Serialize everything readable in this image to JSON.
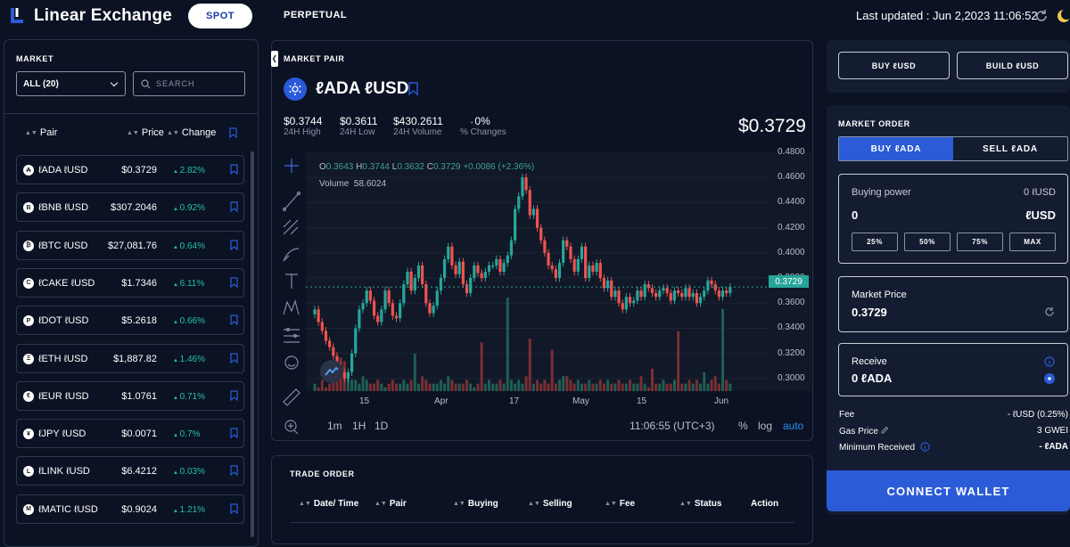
{
  "header": {
    "brand": "Linear Exchange",
    "tabs": [
      "SPOT",
      "PERPETUAL"
    ],
    "last_updated": "Last updated : Jun 2,2023 11:06:52"
  },
  "market": {
    "title": "MARKET",
    "filter": "ALL (20)",
    "search_placeholder": "SEARCH",
    "columns": [
      "Pair",
      "Price",
      "Change"
    ],
    "rows": [
      {
        "icon": "₳",
        "pair": "ℓADA ℓUSD",
        "price": "$0.3729",
        "change": "2.82%"
      },
      {
        "icon": "B",
        "pair": "ℓBNB ℓUSD",
        "price": "$307.2046",
        "change": "0.92%"
      },
      {
        "icon": "₿",
        "pair": "ℓBTC ℓUSD",
        "price": "$27,081.76",
        "change": "0.64%"
      },
      {
        "icon": "C",
        "pair": "ℓCAKE ℓUSD",
        "price": "$1.7346",
        "change": "6.11%"
      },
      {
        "icon": "P",
        "pair": "ℓDOT ℓUSD",
        "price": "$5.2618",
        "change": "0.66%"
      },
      {
        "icon": "Ξ",
        "pair": "ℓETH ℓUSD",
        "price": "$1,887.82",
        "change": "1.46%"
      },
      {
        "icon": "€",
        "pair": "ℓEUR ℓUSD",
        "price": "$1.0761",
        "change": "0.71%"
      },
      {
        "icon": "¥",
        "pair": "ℓJPY ℓUSD",
        "price": "$0.0071",
        "change": "0.7%"
      },
      {
        "icon": "L",
        "pair": "ℓLINK ℓUSD",
        "price": "$6.4212",
        "change": "0.03%"
      },
      {
        "icon": "M",
        "pair": "ℓMATIC ℓUSD",
        "price": "$0.9024",
        "change": "1.21%"
      }
    ]
  },
  "pair_panel": {
    "label": "MARKET PAIR",
    "pair": "ℓADA ℓUSD",
    "stats": [
      {
        "value": "$0.3744",
        "label": "24H High"
      },
      {
        "value": "$0.3611",
        "label": "24H Low"
      },
      {
        "value": "$430.2611",
        "label": "24H Volume"
      },
      {
        "value": "0%",
        "label": "% Changes"
      }
    ],
    "price": "$0.3729"
  },
  "chart": {
    "ohlc": {
      "o": "0.3643",
      "h": "0.3744",
      "l": "0.3632",
      "c": "0.3729",
      "chg": "+0.0086 (+2.36%)"
    },
    "volume": "58.6024",
    "last_price_tag": "0.3729",
    "x_ticks": [
      "15",
      "Apr",
      "17",
      "May",
      "15",
      "Jun"
    ],
    "intervals": [
      "1m",
      "1H",
      "1D"
    ],
    "clock": "11:06:55 (UTC+3)",
    "options": [
      "%",
      "log",
      "auto"
    ]
  },
  "chart_data": {
    "type": "candlestick",
    "y_ticks": [
      "0.4800",
      "0.4600",
      "0.4400",
      "0.4200",
      "0.4000",
      "0.3800",
      "0.3600",
      "0.3400",
      "0.3200",
      "0.3000"
    ],
    "ylim": [
      0.29,
      0.48
    ],
    "close": [
      0.355,
      0.345,
      0.338,
      0.33,
      0.325,
      0.318,
      0.31,
      0.305,
      0.3,
      0.305,
      0.32,
      0.34,
      0.355,
      0.36,
      0.37,
      0.362,
      0.35,
      0.345,
      0.355,
      0.37,
      0.36,
      0.35,
      0.348,
      0.36,
      0.375,
      0.385,
      0.37,
      0.38,
      0.39,
      0.375,
      0.36,
      0.352,
      0.358,
      0.37,
      0.38,
      0.395,
      0.405,
      0.39,
      0.383,
      0.393,
      0.375,
      0.368,
      0.38,
      0.39,
      0.384,
      0.38,
      0.385,
      0.39,
      0.39,
      0.395,
      0.385,
      0.392,
      0.398,
      0.41,
      0.435,
      0.445,
      0.46,
      0.45,
      0.43,
      0.435,
      0.42,
      0.41,
      0.4,
      0.39,
      0.387,
      0.38,
      0.392,
      0.41,
      0.405,
      0.395,
      0.385,
      0.395,
      0.405,
      0.38,
      0.39,
      0.385,
      0.392,
      0.38,
      0.372,
      0.378,
      0.365,
      0.37,
      0.36,
      0.355,
      0.365,
      0.36,
      0.362,
      0.37,
      0.365,
      0.375,
      0.372,
      0.368,
      0.365,
      0.37,
      0.372,
      0.368,
      0.362,
      0.37,
      0.368,
      0.365,
      0.372,
      0.365,
      0.368,
      0.36,
      0.365,
      0.37,
      0.378,
      0.375,
      0.37,
      0.365,
      0.37,
      0.368,
      0.3729
    ],
    "volume": [
      2,
      1,
      3,
      1,
      2,
      4,
      6,
      9,
      8,
      5,
      3,
      3,
      2,
      4,
      3,
      2,
      2,
      3,
      2,
      1,
      2,
      3,
      2,
      2,
      3,
      2,
      3,
      10,
      2,
      4,
      3,
      2,
      2,
      2,
      3,
      2,
      4,
      3,
      2,
      2,
      2,
      3,
      2,
      1,
      2,
      13,
      2,
      3,
      2,
      2,
      3,
      2,
      25,
      3,
      2,
      3,
      2,
      4,
      14,
      2,
      3,
      2,
      3,
      2,
      11,
      2,
      3,
      4,
      4,
      3,
      2,
      3,
      2,
      2,
      3,
      2,
      2,
      3,
      2,
      3,
      2,
      2,
      3,
      2,
      2,
      3,
      2,
      2,
      4,
      2,
      1,
      6,
      2,
      2,
      3,
      2,
      2,
      3,
      16,
      2,
      2,
      3,
      2,
      3,
      2,
      5,
      2,
      3,
      4,
      2,
      22,
      3,
      2,
      2
    ]
  },
  "trade_order": {
    "title": "TRADE ORDER",
    "columns": [
      "Date/ Time",
      "Pair",
      "Buying",
      "Selling",
      "Fee",
      "Status",
      "Action"
    ]
  },
  "right": {
    "buy_usd": "BUY ℓUSD",
    "build_usd": "BUILD ℓUSD",
    "market_order": "MARKET ORDER",
    "tab_buy": "BUY ℓADA",
    "tab_sell": "SELL ℓADA",
    "buying_power_label": "Buying power",
    "buying_power_value": "0 ℓUSD",
    "amount": "0",
    "amount_unit": "ℓUSD",
    "pct_buttons": [
      "25%",
      "50%",
      "75%",
      "MAX"
    ],
    "market_price_label": "Market Price",
    "market_price_value": "0.3729",
    "receive_label": "Receive",
    "receive_value": "0 ℓADA",
    "fee_label": "Fee",
    "fee_value": "- ℓUSD (0.25%)",
    "gas_label": "Gas Price",
    "gas_value": "3 GWEI",
    "min_label": "Minimum Received",
    "min_value": "- ℓADA",
    "connect": "CONNECT WALLET"
  },
  "colors": {
    "accent": "#2b5bd6",
    "up": "#26a69a",
    "down": "#ef5350",
    "bg": "#0b1223"
  }
}
